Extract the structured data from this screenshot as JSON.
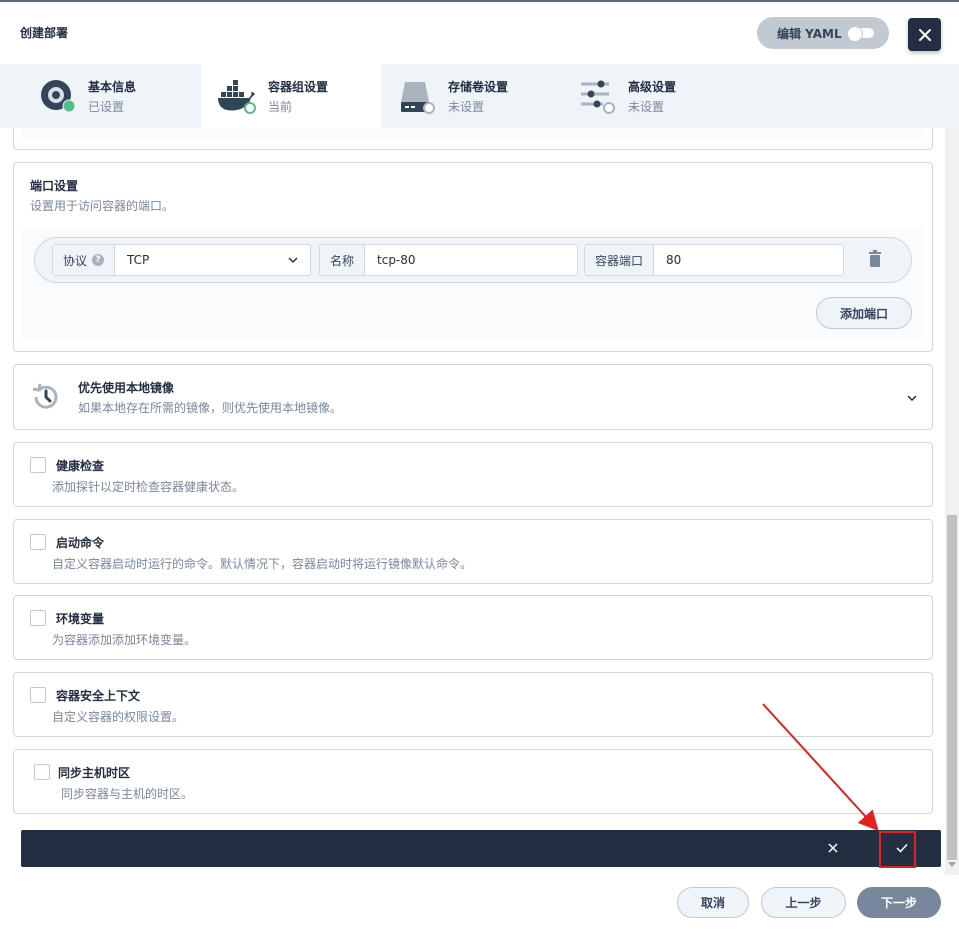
{
  "header": {
    "title": "创建部署",
    "yaml_label": "编辑 YAML"
  },
  "steps": [
    {
      "label": "基本信息",
      "status": "已设置"
    },
    {
      "label": "容器组设置",
      "status": "当前"
    },
    {
      "label": "存储卷设置",
      "status": "未设置"
    },
    {
      "label": "高级设置",
      "status": "未设置"
    }
  ],
  "ports": {
    "title": "端口设置",
    "desc": "设置用于访问容器的端口。",
    "protocol_label": "协议",
    "protocol_value": "TCP",
    "name_label": "名称",
    "name_value": "tcp-80",
    "port_label": "容器端口",
    "port_value": "80",
    "add_label": "添加端口"
  },
  "image_pref": {
    "title": "优先使用本地镜像",
    "desc": "如果本地存在所需的镜像，则优先使用本地镜像。"
  },
  "options": [
    {
      "title": "健康检查",
      "desc": "添加探针以定时检查容器健康状态。"
    },
    {
      "title": "启动命令",
      "desc": "自定义容器启动时运行的命令。默认情况下，容器启动时将运行镜像默认命令。"
    },
    {
      "title": "环境变量",
      "desc": "为容器添加添加环境变量。"
    },
    {
      "title": "容器安全上下文",
      "desc": "自定义容器的权限设置。"
    },
    {
      "title": "同步主机时区",
      "desc": "同步容器与主机的时区。"
    }
  ],
  "footer": {
    "cancel": "取消",
    "prev": "上一步",
    "next": "下一步"
  },
  "colors": {
    "dark": "#242e42",
    "accent_green": "#55bc8a",
    "highlight_red": "#e32020"
  }
}
